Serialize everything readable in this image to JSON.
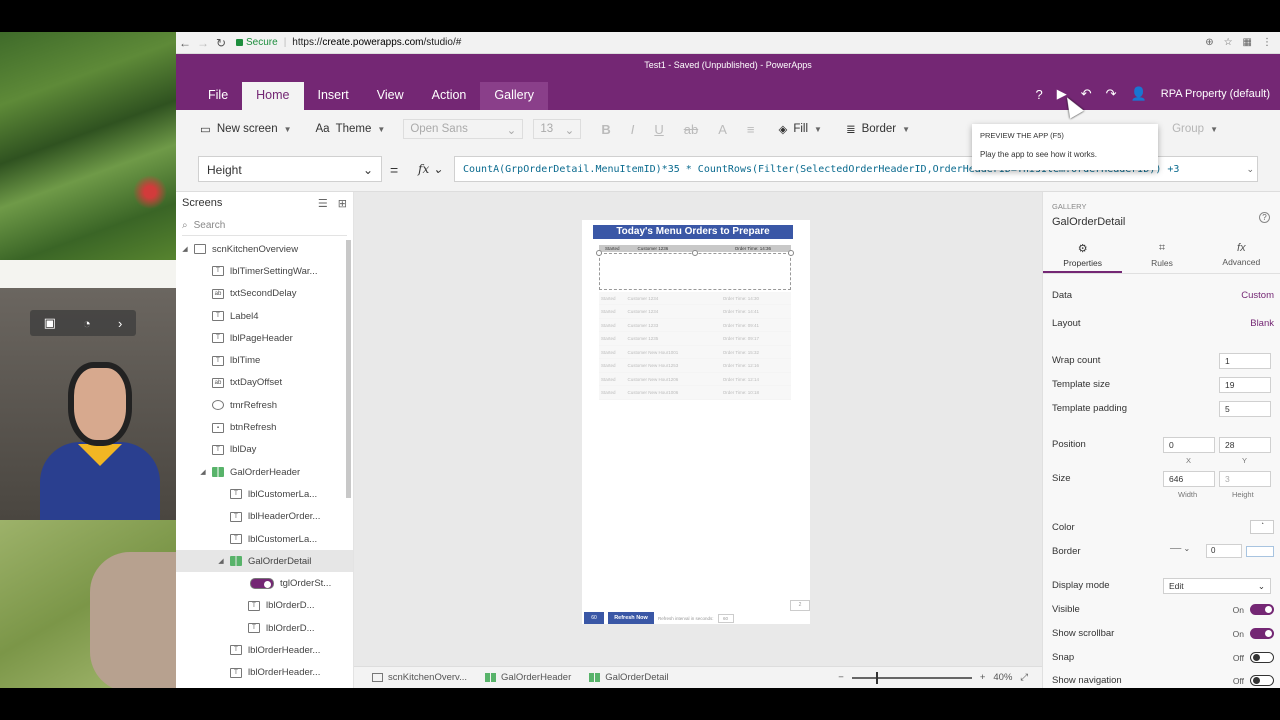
{
  "browser": {
    "secure_label": "Secure",
    "url_scheme": "https://",
    "url_host": "create.powerapps.com",
    "url_path": "/studio/#"
  },
  "app": {
    "title": "Test1 - Saved (Unpublished) - PowerApps",
    "menu": [
      "File",
      "Home",
      "Insert",
      "View",
      "Action",
      "Gallery"
    ],
    "account": "RPA Property (default)",
    "help": "?"
  },
  "toolbar": {
    "new_screen": "New screen",
    "theme": "Theme",
    "font": "Open Sans",
    "font_size": "13",
    "fill": "Fill",
    "border": "Border",
    "group": "Group"
  },
  "tooltip": {
    "title": "PREVIEW THE APP (F5)",
    "body": "Play the app to see how it works."
  },
  "formula": {
    "property": "Height",
    "equals": "=",
    "fx": "fx",
    "text": "CountA(GrpOrderDetail.MenuItemID)*35 * CountRows(Filter(SelectedOrderHeaderID,OrderHeaderID=ThisItem.OrderHeaderID)) +3"
  },
  "screens_panel": {
    "title": "Screens",
    "search_placeholder": "Search",
    "items": [
      {
        "label": "scnKitchenOverview",
        "icon": "screen"
      },
      {
        "label": "lblTimerSettingWar...",
        "icon": "label"
      },
      {
        "label": "txtSecondDelay",
        "icon": "textinput"
      },
      {
        "label": "Label4",
        "icon": "label"
      },
      {
        "label": "lblPageHeader",
        "icon": "label"
      },
      {
        "label": "lblTime",
        "icon": "label"
      },
      {
        "label": "txtDayOffset",
        "icon": "textinput"
      },
      {
        "label": "tmrRefresh",
        "icon": "timer"
      },
      {
        "label": "btnRefresh",
        "icon": "button"
      },
      {
        "label": "lblDay",
        "icon": "label"
      },
      {
        "label": "GalOrderHeader",
        "icon": "gallery"
      },
      {
        "label": "lblCustomerLa...",
        "icon": "label"
      },
      {
        "label": "lblHeaderOrder...",
        "icon": "label"
      },
      {
        "label": "lblCustomerLa...",
        "icon": "label"
      },
      {
        "label": "GalOrderDetail",
        "icon": "gallery"
      },
      {
        "label": "tglOrderSt...",
        "icon": "toggle"
      },
      {
        "label": "lblOrderD...",
        "icon": "label"
      },
      {
        "label": "lblOrderD...",
        "icon": "label"
      },
      {
        "label": "lblOrderHeader...",
        "icon": "label"
      },
      {
        "label": "lblOrderHeader...",
        "icon": "label"
      }
    ]
  },
  "canvas": {
    "title": "Today's Menu Orders to Prepare",
    "header_cols": [
      "Started",
      "Customer 1236",
      "Order Time: 14:36"
    ],
    "rows": [
      [
        "Started",
        "Customer 1234",
        "Order Time: 14:30"
      ],
      [
        "Started",
        "Customer 1234",
        "Order Time: 14:41"
      ],
      [
        "Started",
        "Customer 1233",
        "Order Time: 09:41"
      ],
      [
        "Started",
        "Customer 1235",
        "Order Time: 09:17"
      ],
      [
        "Started",
        "Customer New Hour1001",
        "Order Time: 15:32"
      ],
      [
        "Started",
        "Customer New Hour1253",
        "Order Time: 12:16"
      ],
      [
        "Started",
        "Customer New Hour1206",
        "Order Time: 12:14"
      ],
      [
        "Started",
        "Customer New Hour1006",
        "Order Time: 10:18"
      ]
    ],
    "footer_count": "60",
    "refresh_btn": "Refresh Now",
    "refresh_label": "Refresh interval in seconds:",
    "refresh_value": "60",
    "side_box": "2"
  },
  "status": {
    "crumbs": [
      "scnKitchenOverv...",
      "GalOrderHeader",
      "GalOrderDetail"
    ],
    "zoom": "40%"
  },
  "props": {
    "category": "GALLERY",
    "name": "GalOrderDetail",
    "tabs": [
      "Properties",
      "Rules",
      "Advanced"
    ],
    "data_label": "Data",
    "data_value": "Custom",
    "layout_label": "Layout",
    "layout_value": "Blank",
    "wrap_label": "Wrap count",
    "wrap_value": "1",
    "tsize_label": "Template size",
    "tsize_value": "19",
    "tpad_label": "Template padding",
    "tpad_value": "5",
    "pos_label": "Position",
    "pos_x": "0",
    "pos_y": "28",
    "x_lbl": "X",
    "y_lbl": "Y",
    "size_label": "Size",
    "size_w": "646",
    "size_h": "3",
    "w_lbl": "Width",
    "h_lbl": "Height",
    "color_label": "Color",
    "border_label": "Border",
    "border_width": "0",
    "display_label": "Display mode",
    "display_value": "Edit",
    "visible_label": "Visible",
    "visible_value": "On",
    "scroll_label": "Show scrollbar",
    "scroll_value": "On",
    "snap_label": "Snap",
    "snap_value": "Off",
    "nav_label": "Show navigation",
    "nav_value": "Off"
  },
  "colors": {
    "brand": "#742774",
    "accent_blue": "#3a57a6"
  }
}
